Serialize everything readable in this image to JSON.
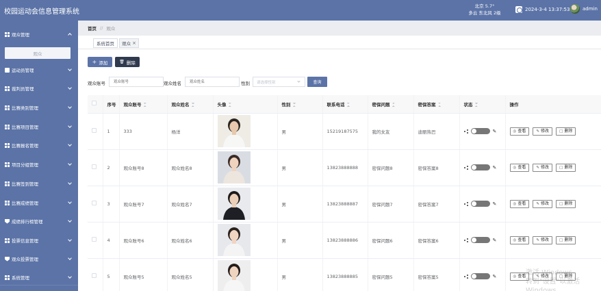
{
  "header": {
    "app_title": "校园运动会信息管理系统",
    "weather_line1": "北京  5.7°",
    "weather_line2": "多云  东北风  2级",
    "datetime": "2024-3-4 13:37:53",
    "username": "admin"
  },
  "sidebar": {
    "items": [
      {
        "label": "观众管理",
        "icon": "grid-icon",
        "expanded": true
      },
      {
        "label": "运动员管理",
        "icon": "box-icon"
      },
      {
        "label": "裁判员管理",
        "icon": "grid-icon"
      },
      {
        "label": "比赛类别管理",
        "icon": "grid-icon"
      },
      {
        "label": "比赛项目管理",
        "icon": "grid-icon"
      },
      {
        "label": "比赛报名管理",
        "icon": "grid-icon"
      },
      {
        "label": "项目分组管理",
        "icon": "grid-icon"
      },
      {
        "label": "比赛签到管理",
        "icon": "grid-icon"
      },
      {
        "label": "比赛成绩管理",
        "icon": "grid-icon"
      },
      {
        "label": "成绩排行榜管理",
        "icon": "flag-icon"
      },
      {
        "label": "投票信息管理",
        "icon": "grid-icon"
      },
      {
        "label": "观众投票管理",
        "icon": "flag-icon"
      },
      {
        "label": "系统管理",
        "icon": "grid-icon"
      }
    ],
    "submenu_label": "观众"
  },
  "breadcrumb": {
    "home": "首页",
    "separator": "//",
    "current": "观众"
  },
  "tabs": [
    {
      "label": "系统首页"
    },
    {
      "label": "观众"
    }
  ],
  "toolbar": {
    "add_label": "添加",
    "delete_label": "删除"
  },
  "search": {
    "account_label": "观众账号",
    "account_placeholder": "观众账号",
    "name_label": "观众姓名",
    "name_placeholder": "观众姓名",
    "gender_label": "性别",
    "gender_placeholder": "请选择性别",
    "query_label": "查询"
  },
  "table": {
    "headers": {
      "index": "序号",
      "account": "观众账号",
      "name": "观众姓名",
      "avatar": "头像",
      "gender": "性别",
      "phone": "联系电话",
      "question": "密保问题",
      "answer": "密保答案",
      "status": "状态",
      "actions": "操作"
    },
    "rows": [
      {
        "index": "1",
        "account": "333",
        "name": "杨洋",
        "gender": "男",
        "phone": "15219187575",
        "question": "我的女友",
        "answer": "迪丽热巴"
      },
      {
        "index": "2",
        "account": "观众账号8",
        "name": "观众姓名8",
        "gender": "男",
        "phone": "13823888888",
        "question": "密保问题8",
        "answer": "密保答案8"
      },
      {
        "index": "3",
        "account": "观众账号7",
        "name": "观众姓名7",
        "gender": "男",
        "phone": "13823888887",
        "question": "密保问题7",
        "answer": "密保答案7"
      },
      {
        "index": "4",
        "account": "观众账号6",
        "name": "观众姓名6",
        "gender": "男",
        "phone": "13823888886",
        "question": "密保问题6",
        "answer": "密保答案6"
      },
      {
        "index": "5",
        "account": "观众账号5",
        "name": "观众姓名5",
        "gender": "男",
        "phone": "13823888885",
        "question": "密保问题5",
        "answer": "密保答案5"
      }
    ],
    "action_view": "查看",
    "action_edit": "修改",
    "action_delete": "删除"
  },
  "watermark": {
    "line1": "激活 Windows",
    "line2": "转到\"设置\"以激活 Windows"
  },
  "colors": {
    "primary": "#5b73a7",
    "dark_button": "#2f3a4f"
  }
}
